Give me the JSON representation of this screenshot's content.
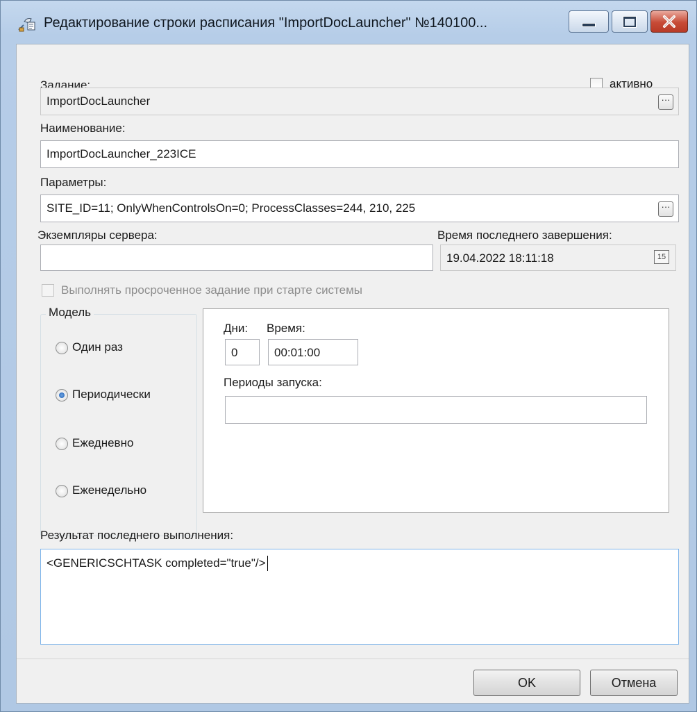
{
  "window": {
    "title": "Редактирование строки расписания \"ImportDocLauncher\" №140100...",
    "minimize_icon": "minimize-icon",
    "maximize_icon": "maximize-icon",
    "close_icon": "close-icon"
  },
  "task": {
    "label": "Задание:",
    "value": "ImportDocLauncher",
    "active_label": "активно",
    "active_checked": false
  },
  "name": {
    "label": "Наименование:",
    "value": "ImportDocLauncher_223ICE"
  },
  "parameters": {
    "label": "Параметры:",
    "value": "SITE_ID=11; OnlyWhenControlsOn=0; ProcessClasses=244, 210, 225"
  },
  "server_instances": {
    "label": "Экземпляры сервера:",
    "value": ""
  },
  "last_completion": {
    "label": "Время последнего завершения:",
    "value": "19.04.2022 18:11:18",
    "calendar_icon_text": "15"
  },
  "run_overdue": {
    "label": "Выполнять просроченное задание при старте системы",
    "checked": false,
    "enabled": false
  },
  "model": {
    "label": "Модель",
    "options": [
      {
        "label": "Один раз",
        "selected": false
      },
      {
        "label": "Периодически",
        "selected": true
      },
      {
        "label": "Ежедневно",
        "selected": false
      },
      {
        "label": "Еженедельно",
        "selected": false
      }
    ]
  },
  "schedule": {
    "days_label": "Дни:",
    "days_value": "0",
    "time_label": "Время:",
    "time_value": "00:01:00",
    "periods_label": "Периоды запуска:",
    "periods_value": ""
  },
  "last_result": {
    "label": "Результат последнего выполнения:",
    "value": "<GENERICSCHTASK completed=\"true\"/>"
  },
  "buttons": {
    "ok": "OK",
    "cancel": "Отмена"
  },
  "colors": {
    "frame": "#b6cde8",
    "client": "#f0f0f0",
    "close_button": "#c74b36",
    "radio_selected": "#1d5fb7"
  }
}
